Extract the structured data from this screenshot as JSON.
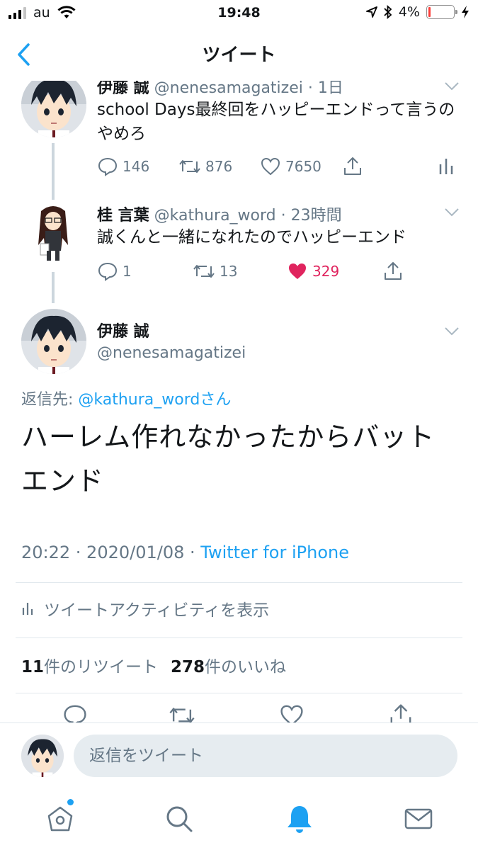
{
  "status_bar": {
    "carrier": "au",
    "time": "19:48",
    "battery_percent": "4%",
    "battery_level": 0.04,
    "battery_color": "#fc3d39"
  },
  "nav": {
    "title": "ツイート",
    "back_icon": "chevron-left-icon"
  },
  "thread": [
    {
      "name": "伊藤 誠",
      "handle": "@nenesamagatizei",
      "time": "1日",
      "text": "school Days最終回をハッピーエンドって言うのやめろ",
      "replies": "146",
      "retweets": "876",
      "likes": "7650",
      "liked": false
    },
    {
      "name": "桂 言葉",
      "handle": "@kathura_word",
      "time": "23時間",
      "text": "誠くんと一緒になれたのでハッピーエンド",
      "replies": "1",
      "retweets": "13",
      "likes": "329",
      "liked": true
    }
  ],
  "main_tweet": {
    "name": "伊藤 誠",
    "handle": "@nenesamagatizei",
    "reply_prefix": "返信先: ",
    "reply_mention": "@kathura_word",
    "reply_suffix": "さん",
    "text": "ハーレム作れなかったからバットエンド",
    "timestamp": "20:22 · 2020/01/08 · ",
    "source": "Twitter for iPhone",
    "activity_label": "ツイートアクティビティを表示",
    "retweet_count": "11",
    "retweet_label": "件のリツイート",
    "like_count": "278",
    "like_label": "件のいいね"
  },
  "reply_bar": {
    "placeholder": "返信をツイート"
  },
  "tab_bar": [
    "home-icon",
    "search-icon",
    "notifications-icon",
    "messages-icon"
  ],
  "colors": {
    "accent": "#1da1f2",
    "like": "#e0245e",
    "secondary_text": "#657786"
  }
}
